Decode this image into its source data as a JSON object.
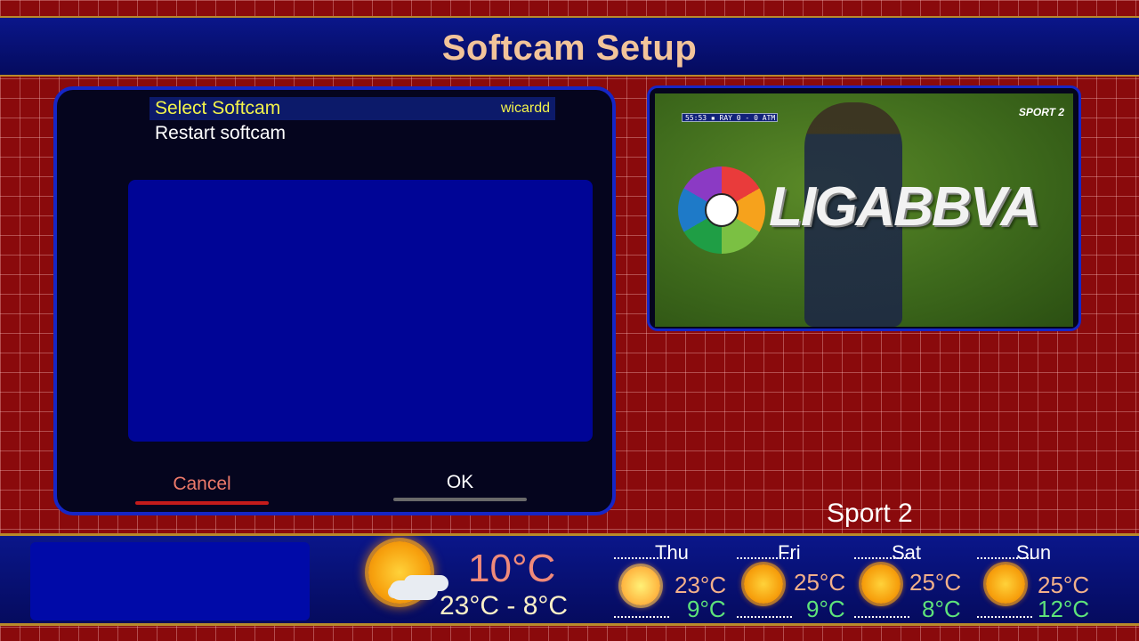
{
  "header": {
    "title": "Softcam Setup"
  },
  "menu": {
    "items": [
      {
        "label": "Select Softcam",
        "value": "wicardd"
      },
      {
        "label": "Restart softcam",
        "value": ""
      }
    ]
  },
  "buttons": {
    "cancel": "Cancel",
    "ok": "OK"
  },
  "preview": {
    "scorebar": "55:53 ▪ RAY 0 - 0 ATM",
    "channel_logo": "SPORT 2",
    "logo_text": "LIGABBVA"
  },
  "channel": {
    "name": "Sport 2"
  },
  "weather": {
    "today": {
      "temp": "10°C",
      "range": "23°C - 8°C",
      "icon": "sun-cloud-icon"
    },
    "forecast": [
      {
        "day": "Thu",
        "high": "23°C",
        "low": "9°C",
        "icon": "sun-haze-icon"
      },
      {
        "day": "Fri",
        "high": "25°C",
        "low": "9°C",
        "icon": "sun-icon"
      },
      {
        "day": "Sat",
        "high": "25°C",
        "low": "8°C",
        "icon": "sun-icon"
      },
      {
        "day": "Sun",
        "high": "25°C",
        "low": "12°C",
        "icon": "sun-icon"
      }
    ]
  },
  "colors": {
    "title": "#f2c49a",
    "selected_text": "#f2f24a",
    "panel_border": "#1626c6",
    "background": "#8a0a0c"
  }
}
